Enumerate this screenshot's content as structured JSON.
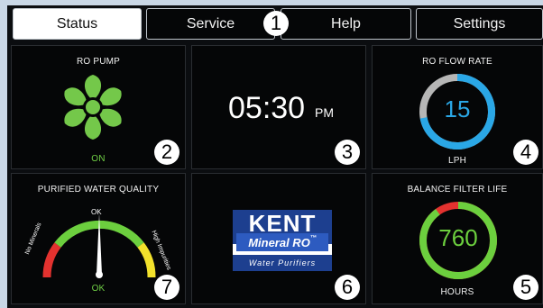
{
  "tabs": [
    {
      "label": "Status",
      "active": true
    },
    {
      "label": "Service",
      "active": false
    },
    {
      "label": "Help",
      "active": false
    },
    {
      "label": "Settings",
      "active": false
    }
  ],
  "callouts": [
    "1",
    "2",
    "3",
    "4",
    "5",
    "6",
    "7"
  ],
  "ro_pump": {
    "title": "RO PUMP",
    "status": "ON",
    "icon": "fan-icon",
    "color": "#74c84a"
  },
  "clock": {
    "time": "05:30",
    "ampm": "PM"
  },
  "ro_flow_rate": {
    "title": "RO FLOW RATE",
    "value": "15",
    "unit": "LPH",
    "fraction": 0.72,
    "ring_color": "#2aa7e6",
    "track_color": "#b6b6b6"
  },
  "balance_filter_life": {
    "title": "BALANCE FILTER LIFE",
    "value": "760",
    "unit": "HOURS",
    "fraction": 0.9,
    "ring_color": "#6ccf3e",
    "warn_color": "#e3322f"
  },
  "water_quality": {
    "title": "PURIFIED WATER QUALITY",
    "labels": {
      "left": "No Minerals",
      "top": "OK",
      "right": "High Impurities"
    },
    "status": "OK",
    "colors": {
      "low": "#e3322f",
      "ok": "#6ccf3e",
      "high": "#f2e12c"
    }
  },
  "brand": {
    "name": "KENT",
    "line2": "Mineral RO",
    "tm": "™",
    "line3": "Water Purifiers"
  }
}
